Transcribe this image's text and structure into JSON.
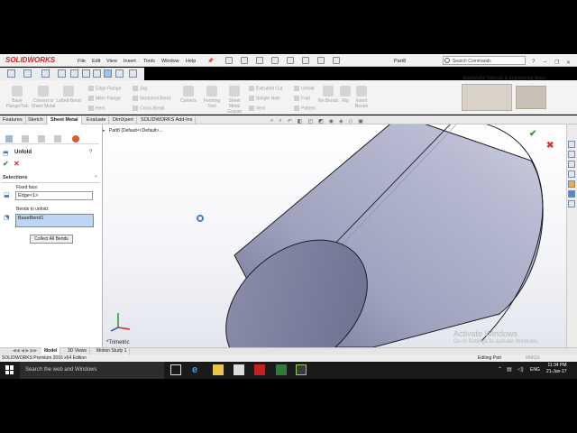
{
  "app": {
    "logo": "SOLIDWORKS",
    "menu": [
      "File",
      "Edit",
      "View",
      "Insert",
      "Tools",
      "Window",
      "Help"
    ],
    "doc_title": "Part8",
    "search_placeholder": "Search Commands"
  },
  "ribbon": {
    "big_buttons": [
      "Base Flange/Tab",
      "Convert to Sheet Metal",
      "Lofted-Bend"
    ],
    "small_col1": [
      "Edge Flange",
      "Miter Flange",
      "Hem"
    ],
    "small_col2": [
      "Jog",
      "Sketched Bend",
      "Cross-Break"
    ],
    "corners": "Corners",
    "forming": "Forming Tool",
    "gusset": "Sheet Metal Gusset",
    "small_col3": [
      "Extruded Cut",
      "Simple Hole",
      "Vent"
    ],
    "small_col4": [
      "Unfold",
      "Fold",
      "Pattern"
    ],
    "no_bends": "No Bends",
    "rip": "Rip",
    "insert_bends": "Insert Bends"
  },
  "news": {
    "title": "SolidWorks Tutorials & Engineering News"
  },
  "tabs": [
    "Features",
    "Sketch",
    "Sheet Metal",
    "Evaluate",
    "DimXpert",
    "SOLIDWORKS Add-Ins"
  ],
  "active_tab": "Sheet Metal",
  "property_manager": {
    "title": "Unfold",
    "selections_header": "Selections",
    "fixed_face_label": "Fixed face:",
    "fixed_face_value": "Edge<1>",
    "bends_label": "Bends to unfold:",
    "bends_value": "BaseBend1",
    "collect_button": "Collect All Bends"
  },
  "viewport": {
    "tree_item": "Part8  (Default<<Default>...",
    "view_label": "*Trimetric"
  },
  "watermark": {
    "line1": "Activate Windows",
    "line2": "Go to Settings to activate Windows."
  },
  "bottom_tabs": [
    "Model",
    "3D Views",
    "Motion Study 1"
  ],
  "status": {
    "left": "SOLIDWORKS Premium 2016 x64 Edition",
    "mode": "Editing Part",
    "units": "MMGS"
  },
  "taskbar": {
    "search_placeholder": "Search the web and Windows",
    "lang": "ENG",
    "time": "11:34 PM",
    "date": "21-Jun-17"
  }
}
